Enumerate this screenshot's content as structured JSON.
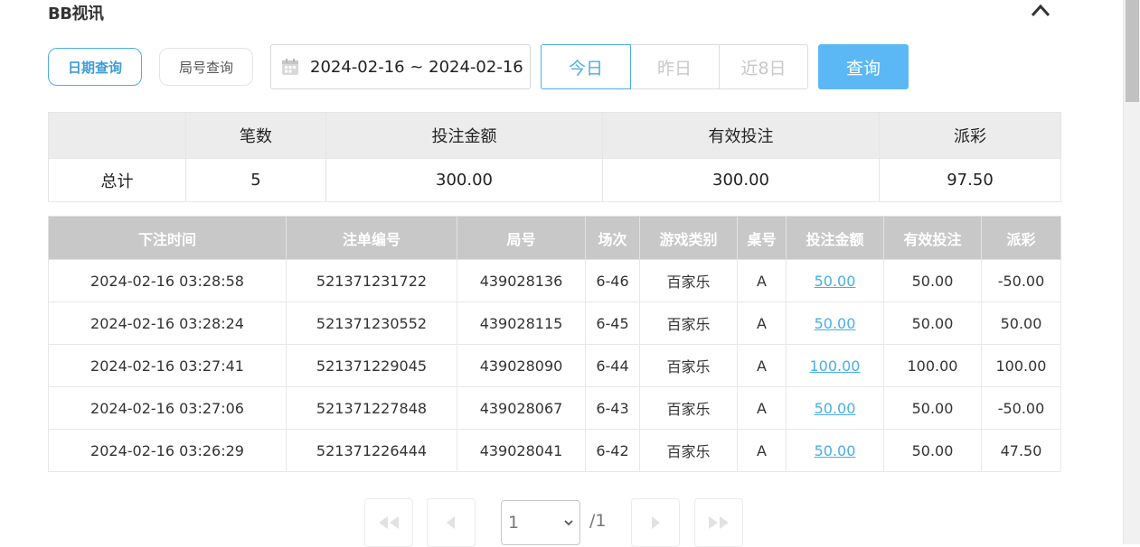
{
  "header": {
    "title": "BB视讯",
    "collapse_icon": "chevron-up-icon"
  },
  "filters": {
    "mode_date_label": "日期查询",
    "mode_round_label": "局号查询",
    "date_range": "2024-02-16 ~ 2024-02-16",
    "calendar_icon": "calendar-icon",
    "quick": {
      "today": "今日",
      "yesterday": "昨日",
      "last8": "近8日"
    },
    "query_label": "查询"
  },
  "summary": {
    "headers": [
      "",
      "笔数",
      "投注金额",
      "有效投注",
      "派彩"
    ],
    "row": {
      "label": "总计",
      "count": "5",
      "bet": "300.00",
      "valid": "300.00",
      "payout": "97.50"
    }
  },
  "records": {
    "headers": [
      "下注时间",
      "注单编号",
      "局号",
      "场次",
      "游戏类别",
      "桌号",
      "投注金额",
      "有效投注",
      "派彩"
    ],
    "rows": [
      {
        "time": "2024-02-16 03:28:58",
        "bet_no": "521371231722",
        "round": "439028136",
        "session": "6-46",
        "game": "百家乐",
        "table": "A",
        "bet": "50.00",
        "valid": "50.00",
        "payout": "-50.00"
      },
      {
        "time": "2024-02-16 03:28:24",
        "bet_no": "521371230552",
        "round": "439028115",
        "session": "6-45",
        "game": "百家乐",
        "table": "A",
        "bet": "50.00",
        "valid": "50.00",
        "payout": "50.00"
      },
      {
        "time": "2024-02-16 03:27:41",
        "bet_no": "521371229045",
        "round": "439028090",
        "session": "6-44",
        "game": "百家乐",
        "table": "A",
        "bet": "100.00",
        "valid": "100.00",
        "payout": "100.00"
      },
      {
        "time": "2024-02-16 03:27:06",
        "bet_no": "521371227848",
        "round": "439028067",
        "session": "6-43",
        "game": "百家乐",
        "table": "A",
        "bet": "50.00",
        "valid": "50.00",
        "payout": "-50.00"
      },
      {
        "time": "2024-02-16 03:26:29",
        "bet_no": "521371226444",
        "round": "439028041",
        "session": "6-42",
        "game": "百家乐",
        "table": "A",
        "bet": "50.00",
        "valid": "50.00",
        "payout": "47.50"
      }
    ]
  },
  "pagination": {
    "current": "1",
    "total": "/1",
    "icons": [
      "first-page-icon",
      "prev-page-icon",
      "next-page-icon",
      "last-page-icon"
    ]
  },
  "colors": {
    "accent": "#4aaee6",
    "button": "#5bb8f5",
    "negative": "#e24d5c",
    "table_header": "#c8c8c8"
  }
}
